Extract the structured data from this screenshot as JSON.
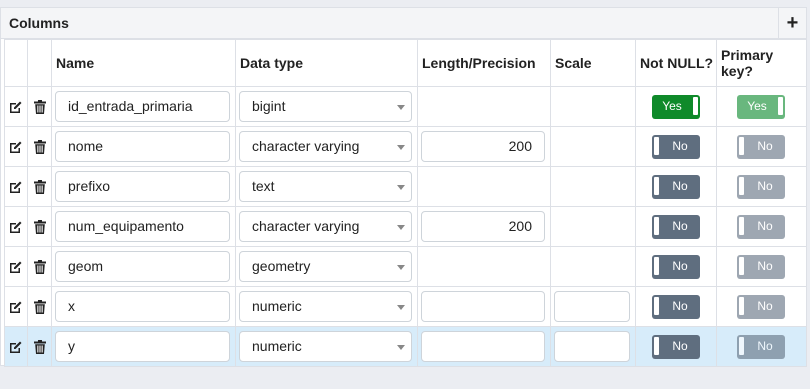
{
  "header": {
    "title": "Columns",
    "add_label": "+"
  },
  "columns": {
    "name": "Name",
    "data_type": "Data type",
    "length": "Length/Precision",
    "scale": "Scale",
    "not_null": "Not NULL?",
    "primary_key": "Primary key?"
  },
  "rows": [
    {
      "name": "id_entrada_primaria",
      "type": "bigint",
      "length": "",
      "scale": "",
      "not_null": "Yes",
      "pk": "Yes"
    },
    {
      "name": "nome",
      "type": "character varying",
      "length": "200",
      "scale": "",
      "not_null": "No",
      "pk": "No"
    },
    {
      "name": "prefixo",
      "type": "text",
      "length": "",
      "scale": "",
      "not_null": "No",
      "pk": "No"
    },
    {
      "name": "num_equipamento",
      "type": "character varying",
      "length": "200",
      "scale": "",
      "not_null": "No",
      "pk": "No"
    },
    {
      "name": "geom",
      "type": "geometry",
      "length": "",
      "scale": "",
      "not_null": "No",
      "pk": "No"
    },
    {
      "name": "x",
      "type": "numeric",
      "length": "",
      "scale": "",
      "not_null": "No",
      "pk": "No"
    },
    {
      "name": "y",
      "type": "numeric",
      "length": "",
      "scale": "",
      "not_null": "No",
      "pk": "No"
    }
  ],
  "colors": {
    "toggle_on": "#0f8a2a",
    "toggle_off": "#5f6e7f",
    "selected_row": "#d7ecfa"
  }
}
